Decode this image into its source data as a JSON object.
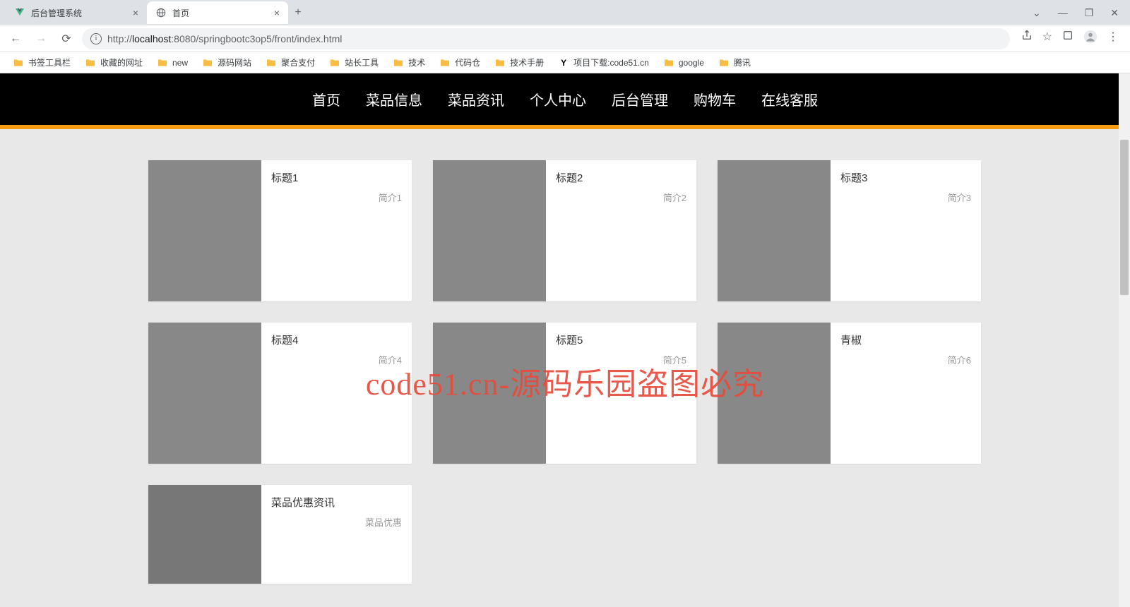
{
  "browser": {
    "tabs": [
      {
        "title": "后台管理系统",
        "favicon": "vue"
      },
      {
        "title": "首页",
        "favicon": "globe"
      }
    ],
    "url_host": "localhost",
    "url_port": ":8080",
    "url_path": "/springbootc3op5/front/index.html",
    "url_scheme": "http://",
    "bookmarks": [
      {
        "label": "书签工具栏",
        "icon": "folder"
      },
      {
        "label": "收藏的网址",
        "icon": "folder"
      },
      {
        "label": "new",
        "icon": "folder"
      },
      {
        "label": "源码网站",
        "icon": "folder"
      },
      {
        "label": "聚合支付",
        "icon": "folder"
      },
      {
        "label": "站长工具",
        "icon": "folder"
      },
      {
        "label": "技术",
        "icon": "folder"
      },
      {
        "label": "代码仓",
        "icon": "folder"
      },
      {
        "label": "技术手册",
        "icon": "folder"
      },
      {
        "label": "项目下载:code51.cn",
        "icon": "y"
      },
      {
        "label": "google",
        "icon": "folder"
      },
      {
        "label": "腾讯",
        "icon": "folder"
      }
    ]
  },
  "nav": {
    "items": [
      "首页",
      "菜品信息",
      "菜品资讯",
      "个人中心",
      "后台管理",
      "购物车",
      "在线客服"
    ]
  },
  "cards": [
    {
      "title": "标题1",
      "desc": "简介1",
      "img": "food1"
    },
    {
      "title": "标题2",
      "desc": "简介2",
      "img": "food2"
    },
    {
      "title": "标题3",
      "desc": "简介3",
      "img": "food3"
    },
    {
      "title": "标题4",
      "desc": "简介4",
      "img": "food4"
    },
    {
      "title": "标题5",
      "desc": "简介5",
      "img": "food5"
    },
    {
      "title": "青椒",
      "desc": "简介6",
      "img": "food6"
    }
  ],
  "news_card": {
    "title": "菜品优惠资讯",
    "desc": "菜品优惠",
    "img": "food7"
  },
  "watermark": "code51.cn-源码乐园盗图必究"
}
